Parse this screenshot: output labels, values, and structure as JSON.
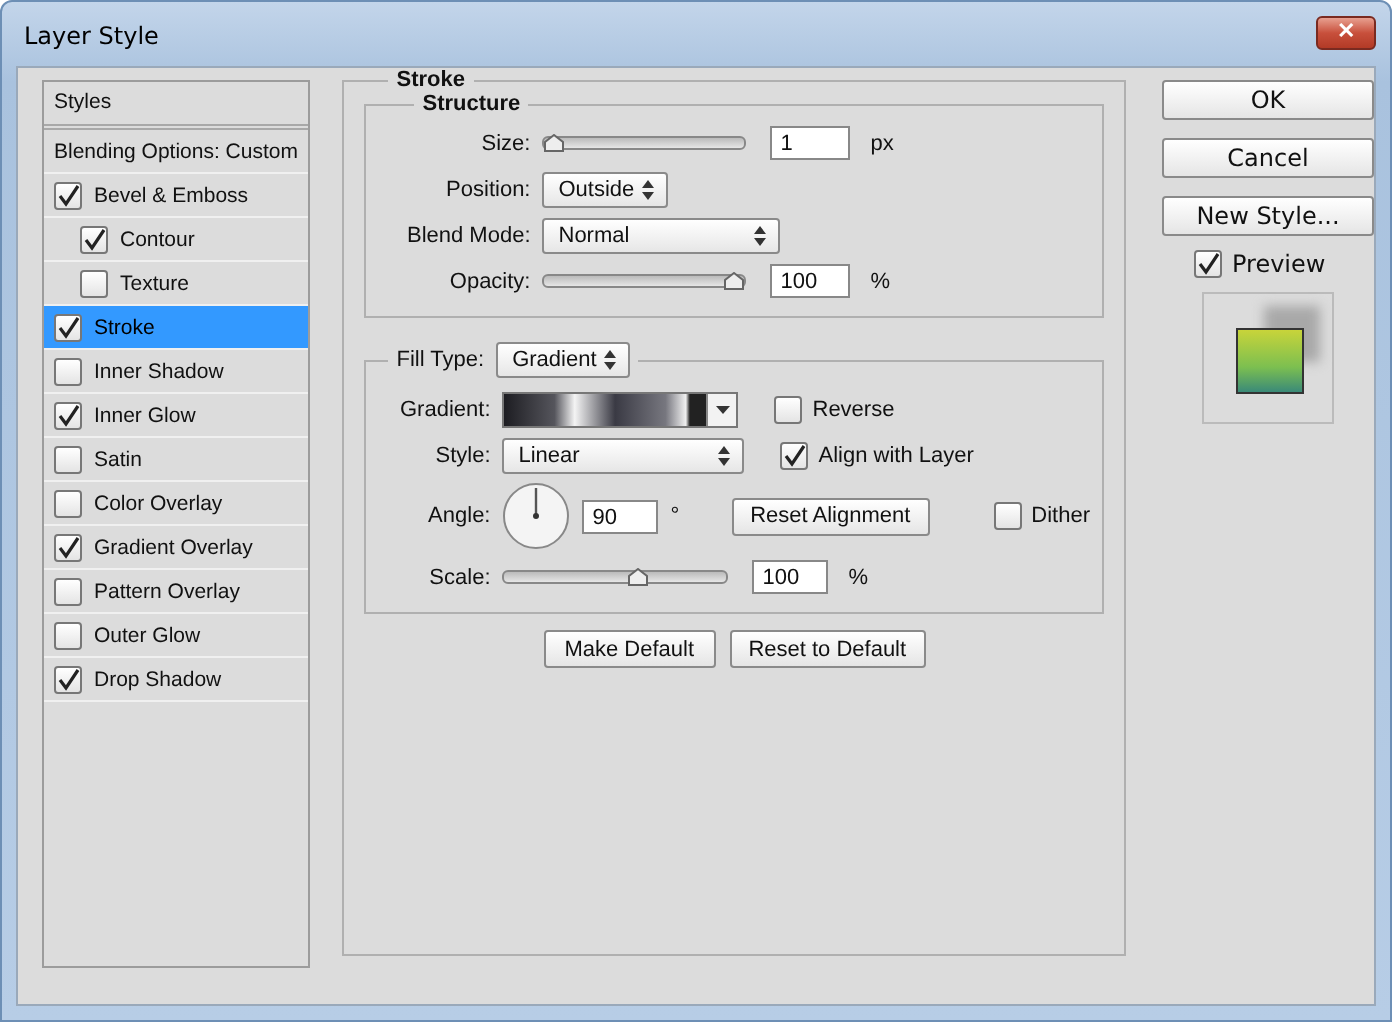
{
  "window": {
    "title": "Layer Style",
    "close_glyph": "✕"
  },
  "sidebar": {
    "header": "Styles",
    "items": [
      {
        "kind": "plain",
        "label": "Blending Options: Custom",
        "selected": false
      },
      {
        "kind": "check",
        "label": "Bevel & Emboss",
        "checked": true,
        "selected": false,
        "children": [
          {
            "kind": "check",
            "label": "Contour",
            "checked": true,
            "selected": false
          },
          {
            "kind": "check",
            "label": "Texture",
            "checked": false,
            "selected": false
          }
        ]
      },
      {
        "kind": "check",
        "label": "Stroke",
        "checked": true,
        "selected": true
      },
      {
        "kind": "check",
        "label": "Inner Shadow",
        "checked": false,
        "selected": false
      },
      {
        "kind": "check",
        "label": "Inner Glow",
        "checked": true,
        "selected": false
      },
      {
        "kind": "check",
        "label": "Satin",
        "checked": false,
        "selected": false
      },
      {
        "kind": "check",
        "label": "Color Overlay",
        "checked": false,
        "selected": false
      },
      {
        "kind": "check",
        "label": "Gradient Overlay",
        "checked": true,
        "selected": false
      },
      {
        "kind": "check",
        "label": "Pattern Overlay",
        "checked": false,
        "selected": false
      },
      {
        "kind": "check",
        "label": "Outer Glow",
        "checked": false,
        "selected": false
      },
      {
        "kind": "check",
        "label": "Drop Shadow",
        "checked": true,
        "selected": false
      }
    ]
  },
  "stroke": {
    "title": "Stroke",
    "structure": {
      "title": "Structure",
      "size": {
        "label": "Size:",
        "level": 0,
        "value": "1",
        "unit": "px"
      },
      "position": {
        "label": "Position:",
        "value": "Outside"
      },
      "blend_mode": {
        "label": "Blend Mode:",
        "value": "Normal"
      },
      "opacity": {
        "label": "Opacity:",
        "level": 1,
        "value": "100",
        "unit": "%"
      }
    },
    "fill": {
      "label": "Fill Type:",
      "value": "Gradient",
      "gradient": {
        "label": "Gradient:"
      },
      "reverse": {
        "label": "Reverse",
        "checked": false
      },
      "style": {
        "label": "Style:",
        "value": "Linear"
      },
      "align": {
        "label": "Align with Layer",
        "checked": true
      },
      "angle": {
        "label": "Angle:",
        "value": "90",
        "unit": "°"
      },
      "reset_alignment": "Reset Alignment",
      "dither": {
        "label": "Dither",
        "checked": false
      },
      "scale": {
        "label": "Scale:",
        "level": 0.61,
        "value": "100",
        "unit": "%"
      }
    },
    "buttons": [
      "Make Default",
      "Reset to Default"
    ]
  },
  "actions": {
    "buttons": [
      "OK",
      "Cancel",
      "New Style..."
    ],
    "preview": {
      "label": "Preview",
      "checked": true
    }
  }
}
